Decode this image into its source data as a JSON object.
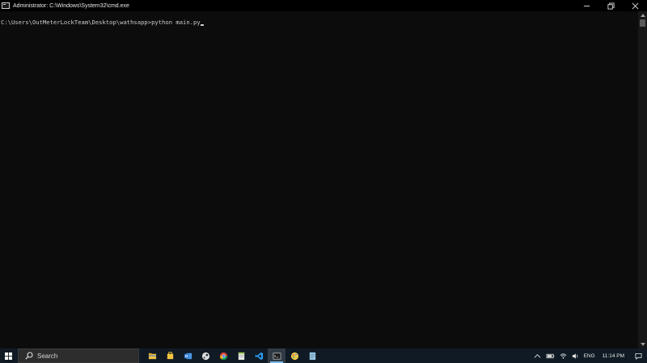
{
  "window": {
    "title": "Administrator: C:\\Windows\\System32\\cmd.exe"
  },
  "console": {
    "prompt_path": "C:\\Users\\OutMeterLockTeam\\Desktop\\wathsapp>",
    "command": "python main.py"
  },
  "taskbar": {
    "search_placeholder": "Search",
    "apps": [
      {
        "name": "file-explorer-icon",
        "color": "#f3c244",
        "active": false
      },
      {
        "name": "store-icon",
        "color": "#f5c542",
        "active": false
      },
      {
        "name": "outlook-icon",
        "color": "#1f6fd1",
        "active": false
      },
      {
        "name": "steam-icon",
        "color": "#dcdcdc",
        "active": false
      },
      {
        "name": "chrome-icon",
        "color": "#db4437",
        "active": false
      },
      {
        "name": "notepad-icon",
        "color": "#9bc54a",
        "active": false
      },
      {
        "name": "vscode-icon",
        "color": "#2d9bf0",
        "active": false
      },
      {
        "name": "cmd-icon",
        "color": "#c8c8c8",
        "active": true
      },
      {
        "name": "paint-icon",
        "color": "#f1c84b",
        "active": false
      },
      {
        "name": "notes-icon",
        "color": "#9ac8e6",
        "active": false
      }
    ],
    "tray": {
      "language": "ENG",
      "time": "11:14 PM"
    }
  },
  "colors": {
    "console_bg": "#0c0c0c",
    "console_fg": "#cccccc",
    "titlebar_bg": "#000000",
    "taskbar_bg": "#0f1a24",
    "active_indicator": "#76b9ed"
  }
}
